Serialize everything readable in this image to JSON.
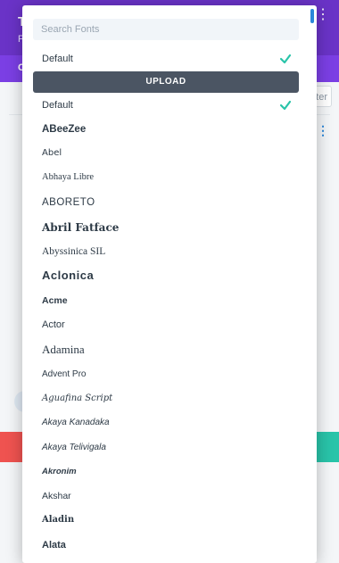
{
  "background": {
    "title_char": "T",
    "subtitle_char": "F",
    "tab_char": "C",
    "filter_text": "ter"
  },
  "dropdown": {
    "search_placeholder": "Search Fonts",
    "selected_font": "Default",
    "upload_label": "UPLOAD",
    "fonts": [
      "Default",
      "ABeeZee",
      "Abel",
      "Abhaya Libre",
      "ABORETO",
      "Abril Fatface",
      "Abyssinica SIL",
      "Aclonica",
      "Acme",
      "Actor",
      "Adamina",
      "Advent Pro",
      "Aguafina Script",
      "Akaya Kanadaka",
      "Akaya Telivigala",
      "Akronim",
      "Akshar",
      "Aladin",
      "Alata"
    ]
  },
  "colors": {
    "header_purple": "#6a33c7",
    "upload_bg": "#4b5563",
    "check_green": "#29c4a9",
    "accent_blue": "#2b87da"
  },
  "icons": {
    "selected": "checkmark-icon"
  }
}
